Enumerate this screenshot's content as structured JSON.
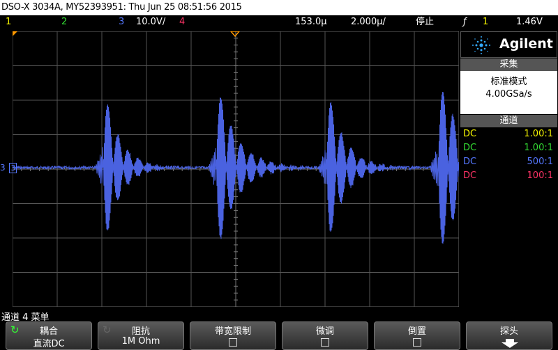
{
  "title": "DSO-X 3034A, MY52393951: Thu Jun 25 08:51:56 2015",
  "status": {
    "ch1": "1",
    "ch2": "2",
    "ch3": "3",
    "ch3_scale": "10.0V/",
    "ch4": "4",
    "time_offset": "153.0µ",
    "time_div": "2.000µ/",
    "run_state": "停止",
    "trigger_icon": "ƒ",
    "trigger_channel": "1",
    "trigger_level": "1.46V"
  },
  "colors": {
    "ch1": "#f5f500",
    "ch2": "#33dd33",
    "ch3": "#5577ff",
    "ch4": "#ff3366",
    "grid": "#5a5a5a",
    "trace": "#4a62e0",
    "accent": "#ff9900"
  },
  "brand": {
    "name": "Agilent"
  },
  "acquire": {
    "header": "采集",
    "mode": "标准模式",
    "rate": "4.00GSa/s"
  },
  "channels": {
    "header": "通道",
    "rows": [
      {
        "coupling": "DC",
        "ratio": "1.00:1",
        "color": "#f5f500"
      },
      {
        "coupling": "DC",
        "ratio": "1.00:1",
        "color": "#33dd33"
      },
      {
        "coupling": "DC",
        "ratio": "500:1",
        "color": "#5577ff"
      },
      {
        "coupling": "DC",
        "ratio": "100:1",
        "color": "#ff3366"
      }
    ]
  },
  "trace_marker": "3",
  "menu": {
    "title": "通道 4 菜单",
    "keys": [
      {
        "title": "耦合",
        "value": "直流DC",
        "icon": "rotate-icon"
      },
      {
        "title": "阻抗",
        "value": "1M Ohm",
        "icon": "rotate-icon"
      },
      {
        "title": "带宽限制",
        "value": ""
      },
      {
        "title": "微调",
        "value": ""
      },
      {
        "title": "倒置",
        "value": ""
      },
      {
        "title": "探头",
        "value": ""
      }
    ]
  }
}
